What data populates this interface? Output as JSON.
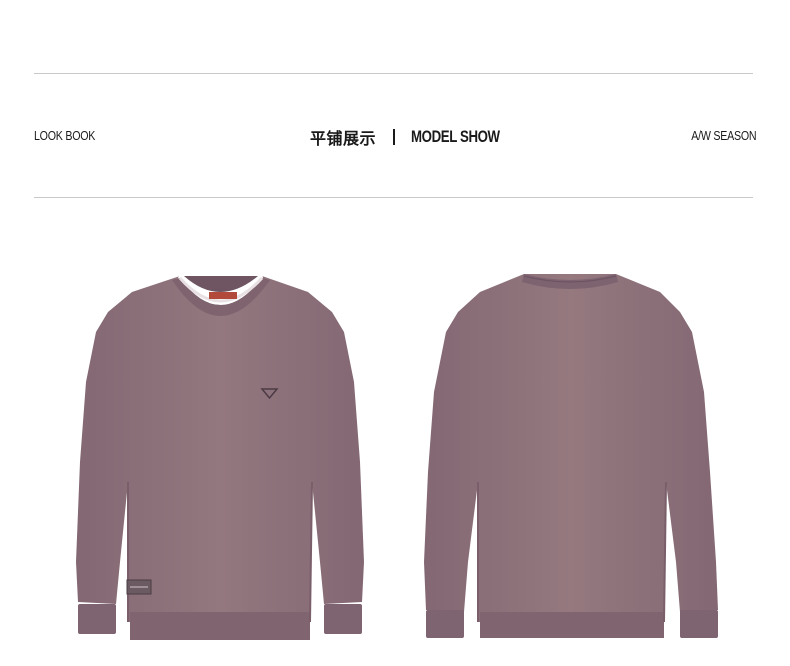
{
  "header": {
    "left_label": "LOOK BOOK",
    "center_title_cn": "平铺展示",
    "center_title_en": "MODEL SHOW",
    "right_label": "A/W SEASON"
  },
  "product": {
    "garment_color": "#8f737f",
    "collar_trim_color": "#ffffff",
    "views": [
      "front-view",
      "back-view"
    ]
  }
}
